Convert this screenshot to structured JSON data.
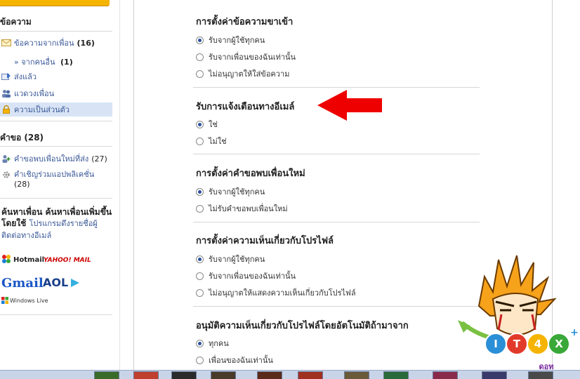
{
  "sidebar": {
    "messages_heading": "ข้อความ",
    "items": [
      {
        "label": "ข้อความจากเพื่อน",
        "count": "(16)"
      },
      {
        "label": "ส่งแล้ว"
      },
      {
        "label": "แวดวงเพื่อน"
      },
      {
        "label": "ความเป็นส่วนตัว"
      }
    ],
    "sub_item": {
      "label": "» จากคนอื่น",
      "count": "(1)"
    },
    "requests_heading": "คำขอ (28)",
    "requests": [
      {
        "label": "คำขอพบเพื่อนใหม่ที่ส่ง",
        "count": "(27)"
      },
      {
        "label": "คำเชิญร่วมแอปพลิเคชั่น",
        "count": "(28)"
      }
    ],
    "find_heading": "ค้นหาเพื่อน ค้นหาเพื่อนเพิ่มขึ้นโดยใช้",
    "find_link": "โปรแกรมดึงรายชื่อผู้ติดต่อทางอีเมล์",
    "logos": {
      "hotmail": "Hotmail",
      "yahoo": "YAHOO! MAIL",
      "gmail": "Gmail",
      "aol": "AOL",
      "windows_live": "Windows Live"
    }
  },
  "sections": [
    {
      "title": "การตั้งค่าข้อความขาเข้า",
      "options": [
        {
          "label": "รับจากผู้ใช้ทุกคน",
          "selected": true
        },
        {
          "label": "รับจากเพื่อนของฉันเท่านั้น",
          "selected": false
        },
        {
          "label": "ไม่อนุญาตให้ใส่ข้อความ",
          "selected": false
        }
      ]
    },
    {
      "title": "รับการแจ้งเตือนทางอีเมล์",
      "options": [
        {
          "label": "ใช่",
          "selected": true
        },
        {
          "label": "ไม่ใช่",
          "selected": false
        }
      ]
    },
    {
      "title": "การตั้งค่าคำขอพบเพื่อนใหม่",
      "options": [
        {
          "label": "รับจากผู้ใช้ทุกคน",
          "selected": true
        },
        {
          "label": "ไม่รับคำขอพบเพื่อนใหม่",
          "selected": false
        }
      ]
    },
    {
      "title": "การตั้งค่าความเห็นเกี่ยวกับโปรไฟล์",
      "options": [
        {
          "label": "รับจากผู้ใช้ทุกคน",
          "selected": true
        },
        {
          "label": "รับจากเพื่อนของฉันเท่านั้น",
          "selected": false
        },
        {
          "label": "ไม่อนุญาตให้แสดงความเห็นเกี่ยวกับโปรไฟล์",
          "selected": false
        }
      ]
    },
    {
      "title": "อนุมัติความเห็นเกี่ยวกับโปรไฟล์โดยอัตโนมัติถ้ามาจาก",
      "options": [
        {
          "label": "ทุกคน",
          "selected": true
        },
        {
          "label": "เพื่อนของฉันเท่านั้น",
          "selected": false
        }
      ]
    }
  ],
  "watermark": {
    "text": "IT4X",
    "sub": "ดอท"
  },
  "colors": {
    "link": "#3b5998",
    "arrow": "#ee0000",
    "accent": "#f5b400",
    "radio_dot": "#2a4f9c"
  }
}
